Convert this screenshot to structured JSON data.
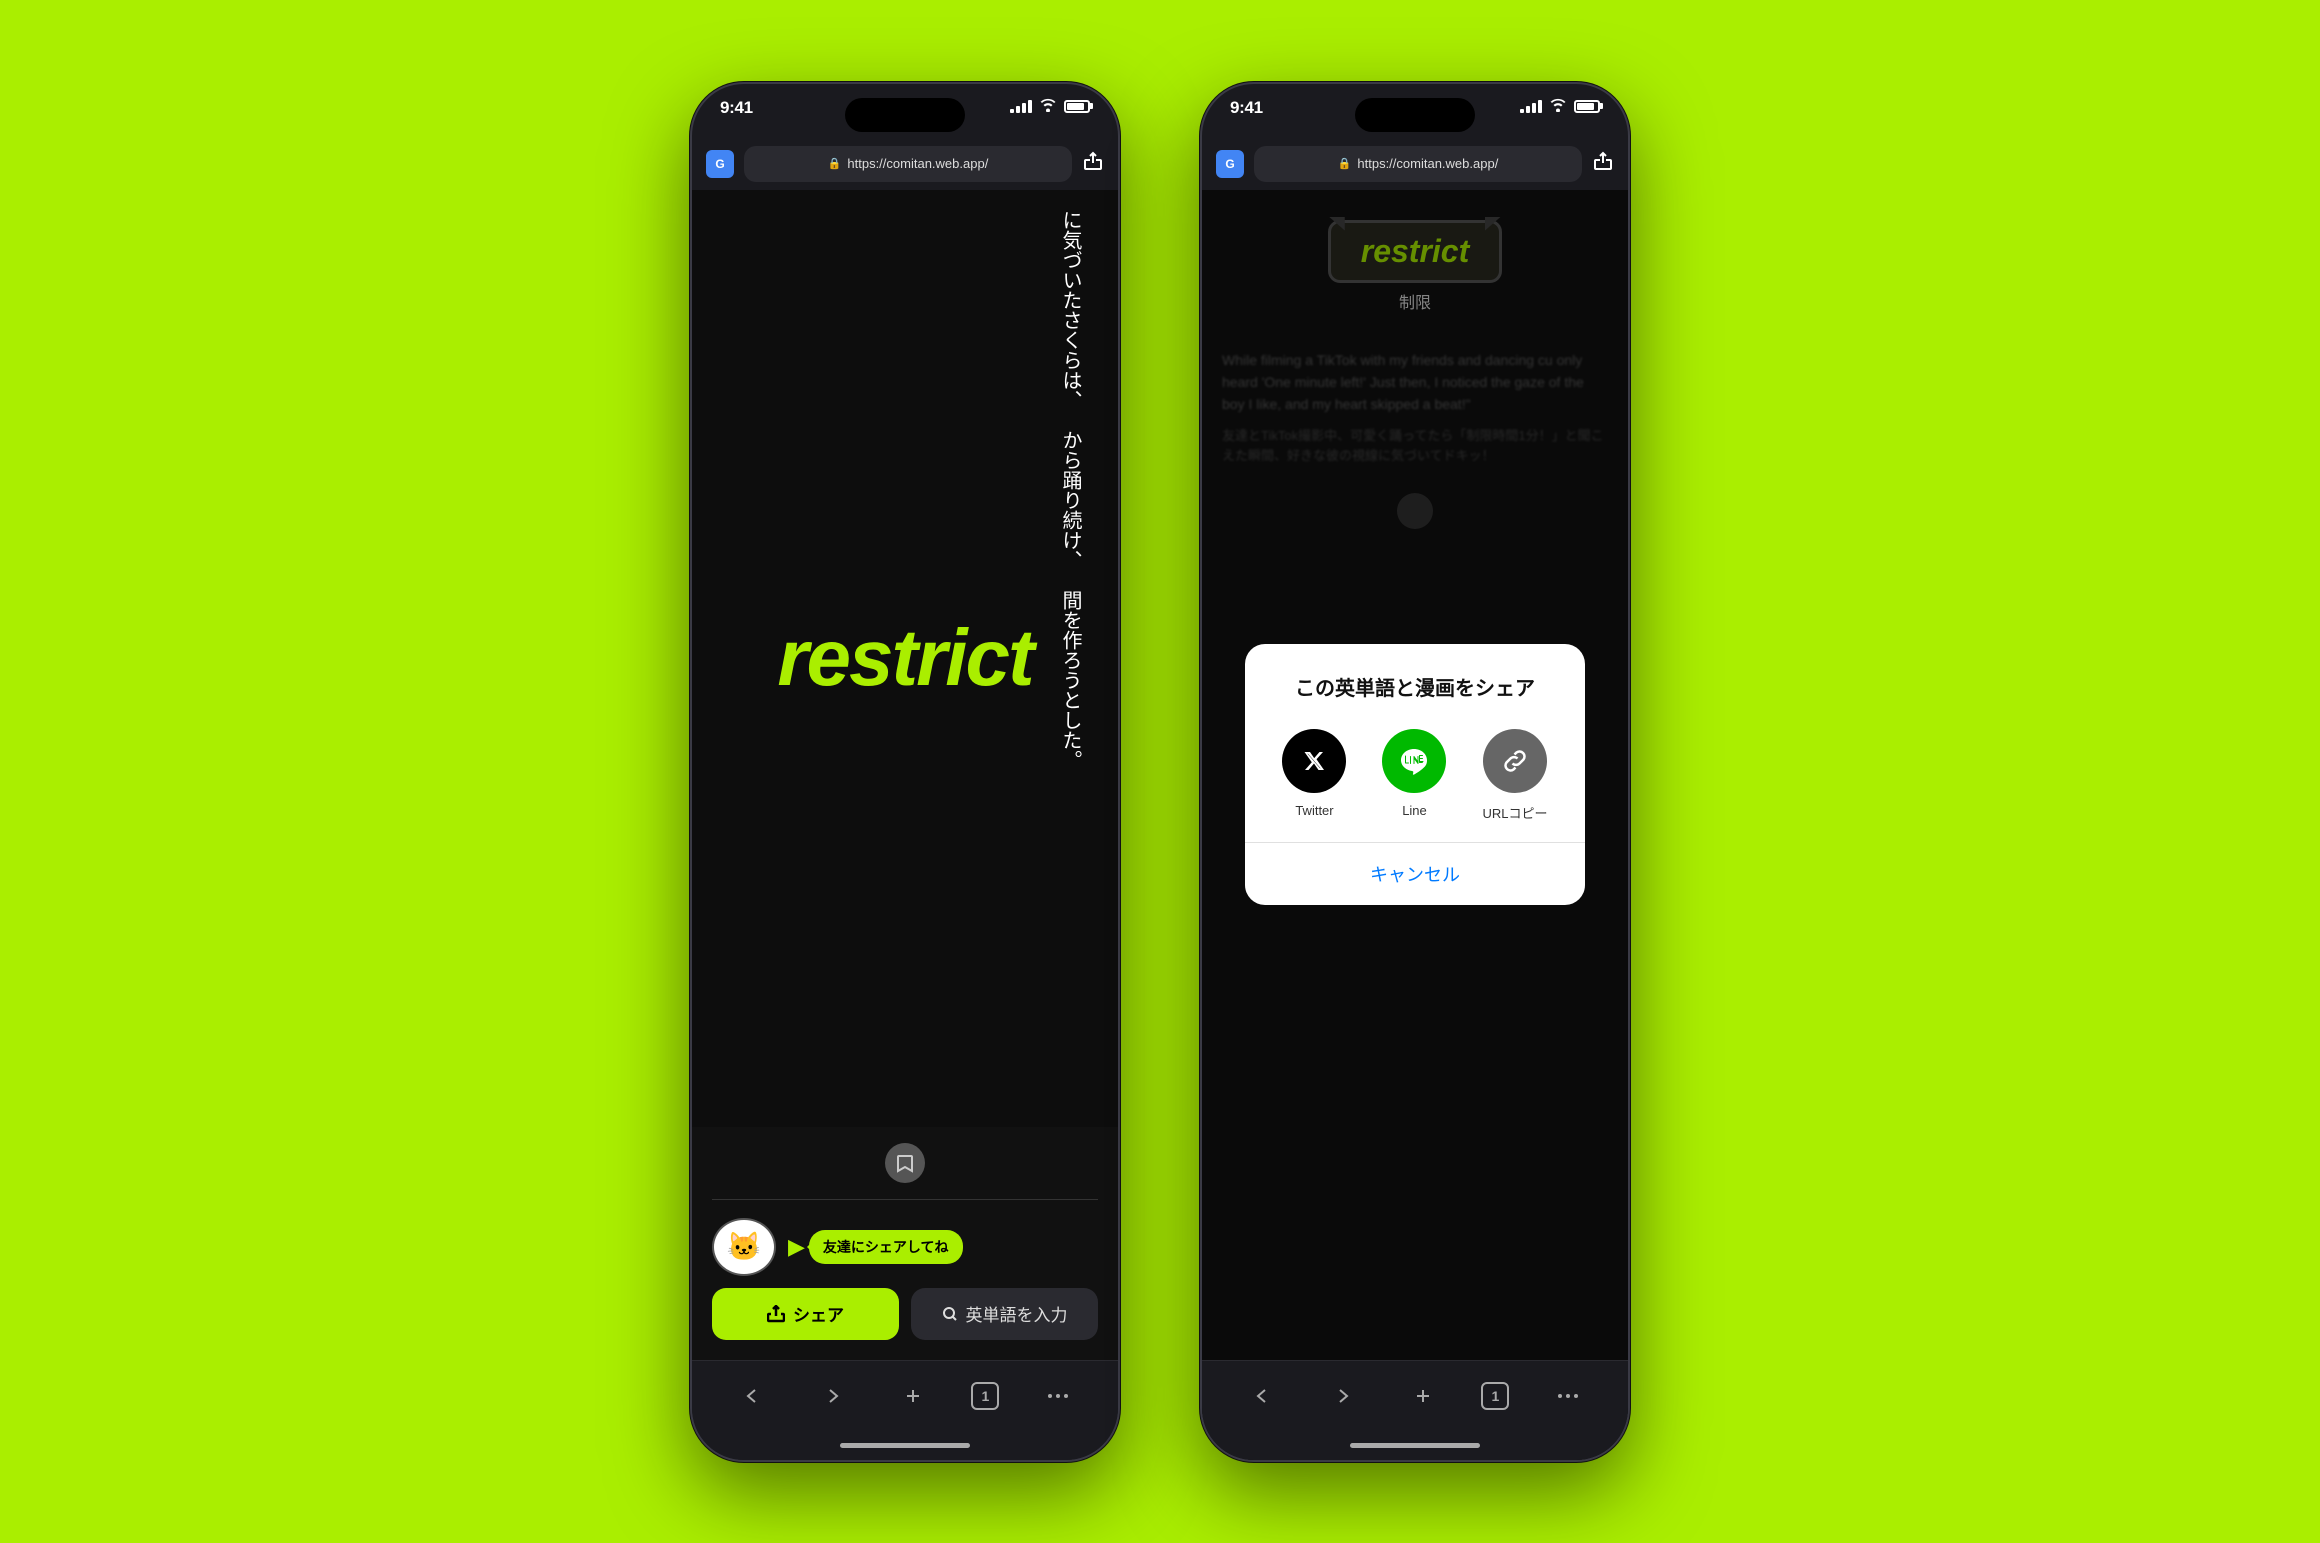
{
  "background_color": "#AAEE00",
  "phone_left": {
    "status": {
      "time": "9:41",
      "signal": "●●●",
      "wifi": "WiFi",
      "battery": "85"
    },
    "address_bar": {
      "url": "https://comitan.web.app/",
      "google_label": "G"
    },
    "manga_text": {
      "col1": "に気づいたさくらは、",
      "col2": "から踊り続け、",
      "col3": "間を作ろうとした。"
    },
    "word": "restrict",
    "share_promo_text": "友達にシェアしてね",
    "btn_share_label": "シェア",
    "btn_search_label": "英単語を入力",
    "nav_tabs": "1"
  },
  "phone_right": {
    "status": {
      "time": "9:41"
    },
    "address_bar": {
      "url": "https://comitan.web.app/"
    },
    "word": "restrict",
    "meaning": "制限",
    "share_dialog": {
      "title": "この英単語と漫画をシェア",
      "twitter_label": "Twitter",
      "line_label": "Line",
      "url_label": "URLコピー",
      "cancel_label": "キャンセル"
    },
    "story_en": "While filming a TikTok with my friends and dancing cu only heard 'One minute left!' Just then, I noticed the gaze of the boy I like, and my heart skipped a beat!\"",
    "story_jp": "友達とTikTok撮影中、可愛く踊ってたら「制限時間1分！」と聞こえた瞬間、好きな彼の視線に気づいてドキッ！",
    "nav_tabs": "1"
  }
}
